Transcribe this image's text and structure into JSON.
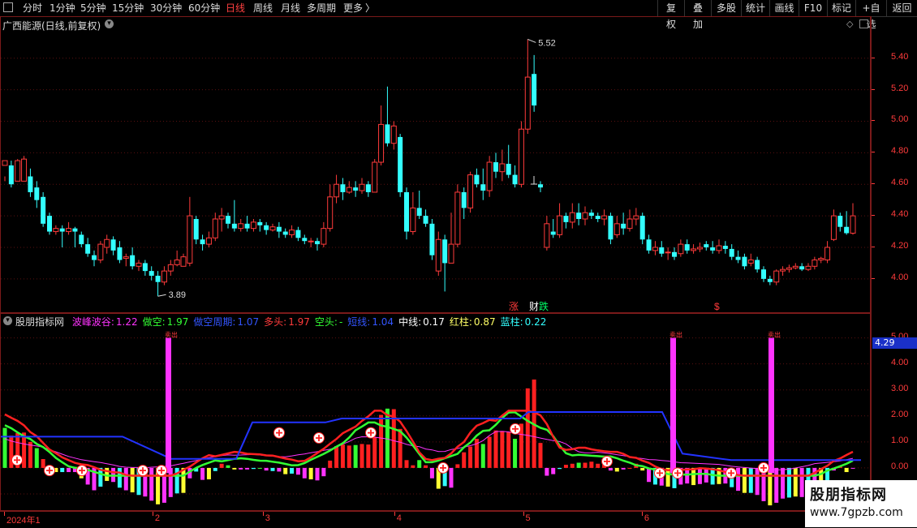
{
  "toolbar": {
    "left_items": [
      {
        "label": "分时",
        "active": false
      },
      {
        "label": "1分钟",
        "active": false
      },
      {
        "label": "5分钟",
        "active": false
      },
      {
        "label": "15分钟",
        "active": false
      },
      {
        "label": "30分钟",
        "active": false
      },
      {
        "label": "60分钟",
        "active": false
      },
      {
        "label": "日线",
        "active": true
      },
      {
        "label": "周线",
        "active": false
      },
      {
        "label": "月线",
        "active": false
      },
      {
        "label": "多周期",
        "active": false
      },
      {
        "label": "更多",
        "active": false
      }
    ],
    "more_arrow": "〉",
    "right_items": [
      "复权",
      "叠加",
      "多股",
      "统计",
      "画线",
      "F10",
      "标记",
      "+自选",
      "返回"
    ]
  },
  "main_chart": {
    "title": "广西能源(日线,前复权)",
    "y_ticks": [
      "5.40",
      "5.20",
      "5.00",
      "4.80",
      "4.60",
      "4.40",
      "4.20",
      "4.00"
    ],
    "y_range": [
      3.85,
      5.62
    ],
    "high_label": "5.52",
    "low_label": "3.89",
    "markers": [
      {
        "text": "涨",
        "color": "#ff3b3b"
      },
      {
        "text": "财",
        "color": "#ffffff"
      },
      {
        "text": "跌",
        "color": "#00ff66"
      },
      {
        "text": "$",
        "color": "#ff3b3b"
      }
    ],
    "candles": [
      [
        4.72,
        4.75,
        4.65,
        4.62
      ],
      [
        4.72,
        4.6,
        4.58,
        4.75
      ],
      [
        4.62,
        4.75,
        4.62,
        4.76
      ],
      [
        4.62,
        4.76,
        4.62,
        4.78
      ],
      [
        4.65,
        4.55,
        4.52,
        4.7
      ],
      [
        4.58,
        4.5,
        4.45,
        4.62
      ],
      [
        4.52,
        4.35,
        4.33,
        4.55
      ],
      [
        4.4,
        4.3,
        4.28,
        4.42
      ],
      [
        4.3,
        4.32,
        4.28,
        4.34
      ],
      [
        4.32,
        4.3,
        4.2,
        4.34
      ],
      [
        4.3,
        4.32,
        4.28,
        4.36
      ],
      [
        4.32,
        4.3,
        4.2,
        4.33
      ],
      [
        4.28,
        4.22,
        4.2,
        4.3
      ],
      [
        4.22,
        4.16,
        4.14,
        4.26
      ],
      [
        4.15,
        4.12,
        4.08,
        4.18
      ],
      [
        4.12,
        4.22,
        4.1,
        4.24
      ],
      [
        4.2,
        4.25,
        4.16,
        4.28
      ],
      [
        4.25,
        4.18,
        4.15,
        4.27
      ],
      [
        4.2,
        4.12,
        4.1,
        4.24
      ],
      [
        4.13,
        4.14,
        4.08,
        4.16
      ],
      [
        4.15,
        4.08,
        4.06,
        4.2
      ],
      [
        4.08,
        4.1,
        4.05,
        4.12
      ],
      [
        4.1,
        4.05,
        4.02,
        4.12
      ],
      [
        4.05,
        4.02,
        3.99,
        4.08
      ],
      [
        4.02,
        3.98,
        3.89,
        4.05
      ],
      [
        3.98,
        4.05,
        3.96,
        4.08
      ],
      [
        4.05,
        4.09,
        4.02,
        4.12
      ],
      [
        4.09,
        4.12,
        4.08,
        4.18
      ],
      [
        4.08,
        4.14,
        4.08,
        4.16
      ],
      [
        4.1,
        4.4,
        4.08,
        4.52
      ],
      [
        4.38,
        4.25,
        4.22,
        4.4
      ],
      [
        4.25,
        4.22,
        4.18,
        4.28
      ],
      [
        4.22,
        4.26,
        4.2,
        4.3
      ],
      [
        4.26,
        4.38,
        4.24,
        4.42
      ],
      [
        4.38,
        4.4,
        4.3,
        4.45
      ],
      [
        4.4,
        4.35,
        4.32,
        4.42
      ],
      [
        4.35,
        4.32,
        4.3,
        4.5
      ],
      [
        4.32,
        4.35,
        4.3,
        4.38
      ],
      [
        4.35,
        4.32,
        4.3,
        4.4
      ],
      [
        4.32,
        4.36,
        4.3,
        4.38
      ],
      [
        4.36,
        4.34,
        4.3,
        4.38
      ],
      [
        4.34,
        4.31,
        4.28,
        4.36
      ],
      [
        4.31,
        4.33,
        4.3,
        4.35
      ],
      [
        4.33,
        4.3,
        4.26,
        4.36
      ],
      [
        4.3,
        4.28,
        4.26,
        4.32
      ],
      [
        4.28,
        4.31,
        4.26,
        4.34
      ],
      [
        4.31,
        4.26,
        4.24,
        4.33
      ],
      [
        4.26,
        4.24,
        4.22,
        4.28
      ],
      [
        4.24,
        4.24,
        4.2,
        4.26
      ],
      [
        4.24,
        4.22,
        4.18,
        4.26
      ],
      [
        4.22,
        4.32,
        4.2,
        4.36
      ],
      [
        4.32,
        4.52,
        4.3,
        4.6
      ],
      [
        4.52,
        4.6,
        4.48,
        4.66
      ],
      [
        4.6,
        4.55,
        4.5,
        4.64
      ],
      [
        4.55,
        4.58,
        4.54,
        4.62
      ],
      [
        4.58,
        4.56,
        4.52,
        4.62
      ],
      [
        4.56,
        4.6,
        4.54,
        4.64
      ],
      [
        4.6,
        4.55,
        4.52,
        4.62
      ],
      [
        4.55,
        4.74,
        4.55,
        4.76
      ],
      [
        4.74,
        4.98,
        4.72,
        5.1
      ],
      [
        4.98,
        4.86,
        4.84,
        5.22
      ],
      [
        4.86,
        4.97,
        4.82,
        5.0
      ],
      [
        4.9,
        4.55,
        4.52,
        4.92
      ],
      [
        4.55,
        4.3,
        4.25,
        4.58
      ],
      [
        4.3,
        4.45,
        4.28,
        4.55
      ],
      [
        4.45,
        4.4,
        4.38,
        4.56
      ],
      [
        4.4,
        4.35,
        4.33,
        4.44
      ],
      [
        4.35,
        4.15,
        4.12,
        4.38
      ],
      [
        4.05,
        4.25,
        4.02,
        4.3
      ],
      [
        4.25,
        4.1,
        3.92,
        4.28
      ],
      [
        4.1,
        4.22,
        4.1,
        4.42
      ],
      [
        4.22,
        4.55,
        4.2,
        4.6
      ],
      [
        4.55,
        4.45,
        4.38,
        4.58
      ],
      [
        4.45,
        4.66,
        4.42,
        4.68
      ],
      [
        4.66,
        4.6,
        4.58,
        4.7
      ],
      [
        4.6,
        4.56,
        4.5,
        4.7
      ],
      [
        4.56,
        4.74,
        4.52,
        4.78
      ],
      [
        4.74,
        4.68,
        4.64,
        4.8
      ],
      [
        4.68,
        4.73,
        4.62,
        4.82
      ],
      [
        4.73,
        4.66,
        4.64,
        4.85
      ],
      [
        4.66,
        4.6,
        4.58,
        4.72
      ],
      [
        4.6,
        4.95,
        4.58,
        5.0
      ],
      [
        4.95,
        5.28,
        4.92,
        5.52
      ],
      [
        5.3,
        5.1,
        5.06,
        5.42
      ],
      [
        4.6,
        4.58,
        4.55,
        4.62
      ],
      [
        4.2,
        4.35,
        4.18,
        4.4
      ],
      [
        4.3,
        4.28,
        4.26,
        4.38
      ],
      [
        4.28,
        4.4,
        4.26,
        4.48
      ],
      [
        4.4,
        4.36,
        4.32,
        4.42
      ],
      [
        4.36,
        4.42,
        4.32,
        4.48
      ],
      [
        4.42,
        4.38,
        4.34,
        4.48
      ],
      [
        4.38,
        4.42,
        4.34,
        4.46
      ],
      [
        4.42,
        4.4,
        4.38,
        4.44
      ],
      [
        4.4,
        4.38,
        4.36,
        4.42
      ],
      [
        4.38,
        4.4,
        4.34,
        4.44
      ],
      [
        4.4,
        4.25,
        4.22,
        4.42
      ],
      [
        4.28,
        4.35,
        4.26,
        4.4
      ],
      [
        4.35,
        4.32,
        4.28,
        4.42
      ],
      [
        4.32,
        4.38,
        4.3,
        4.44
      ],
      [
        4.38,
        4.4,
        4.34,
        4.45
      ],
      [
        4.4,
        4.25,
        4.22,
        4.42
      ],
      [
        4.25,
        4.18,
        4.16,
        4.28
      ],
      [
        4.18,
        4.2,
        4.15,
        4.24
      ],
      [
        4.2,
        4.16,
        4.14,
        4.24
      ],
      [
        4.17,
        4.17,
        4.12,
        4.2
      ],
      [
        4.17,
        4.14,
        4.12,
        4.2
      ],
      [
        4.16,
        4.22,
        4.14,
        4.25
      ],
      [
        4.22,
        4.18,
        4.16,
        4.25
      ],
      [
        4.18,
        4.19,
        4.16,
        4.22
      ],
      [
        4.19,
        4.2,
        4.17,
        4.23
      ],
      [
        4.22,
        4.2,
        4.18,
        4.24
      ],
      [
        4.2,
        4.18,
        4.16,
        4.24
      ],
      [
        4.18,
        4.21,
        4.16,
        4.25
      ],
      [
        4.21,
        4.19,
        4.16,
        4.24
      ],
      [
        4.19,
        4.14,
        4.12,
        4.22
      ],
      [
        4.14,
        4.12,
        4.1,
        4.18
      ],
      [
        4.14,
        4.08,
        4.06,
        4.16
      ],
      [
        4.1,
        4.12,
        4.08,
        4.16
      ],
      [
        4.12,
        4.06,
        4.04,
        4.14
      ],
      [
        4.06,
        4.0,
        3.98,
        4.08
      ],
      [
        4.0,
        3.98,
        3.96,
        4.02
      ],
      [
        3.98,
        4.05,
        3.96,
        4.06
      ],
      [
        4.05,
        4.06,
        4.02,
        4.08
      ],
      [
        4.06,
        4.07,
        4.04,
        4.09
      ],
      [
        4.07,
        4.08,
        4.06,
        4.1
      ],
      [
        4.08,
        4.06,
        4.05,
        4.1
      ],
      [
        4.06,
        4.08,
        4.05,
        4.1
      ],
      [
        4.08,
        4.12,
        4.06,
        4.14
      ],
      [
        4.12,
        4.13,
        4.1,
        4.14
      ],
      [
        4.12,
        4.2,
        4.1,
        4.24
      ],
      [
        4.25,
        4.4,
        4.24,
        4.44
      ],
      [
        4.4,
        4.33,
        4.3,
        4.42
      ],
      [
        4.33,
        4.29,
        4.28,
        4.43
      ],
      [
        4.29,
        4.4,
        4.28,
        4.48
      ]
    ]
  },
  "indicator": {
    "name": "股朋指标网",
    "params": [
      {
        "label": "波峰波谷:",
        "value": "1.22",
        "color": "#ff33ff"
      },
      {
        "label": "做空:",
        "value": "1.97",
        "color": "#33ff33"
      },
      {
        "label": "做空周期:",
        "value": "1.07",
        "color": "#3355ff"
      },
      {
        "label": "多头:",
        "value": "1.97",
        "color": "#ff3b3b"
      },
      {
        "label": "空头:",
        "value": "-",
        "color": "#33ff33"
      },
      {
        "label": "短线:",
        "value": "1.04",
        "color": "#3355ff"
      },
      {
        "label": "中线:",
        "value": "0.17",
        "color": "#ffffff"
      },
      {
        "label": "红柱:",
        "value": "0.87",
        "color": "#ffff66"
      },
      {
        "label": "蓝柱:",
        "value": "0.22",
        "color": "#33ffff"
      }
    ],
    "y_ticks": [
      "5.00",
      "4.00",
      "3.00",
      "2.00",
      "1.00",
      "0.00",
      "-1.00"
    ],
    "y_range": [
      -1.5,
      5.3
    ],
    "current_value": "4.29",
    "signal_text": "卖出"
  },
  "x_axis": {
    "labels": [
      {
        "text": "2024年1",
        "pos": 0.0
      },
      {
        "text": "2",
        "pos": 0.175
      },
      {
        "text": "3",
        "pos": 0.305
      },
      {
        "text": "4",
        "pos": 0.46
      },
      {
        "text": "5",
        "pos": 0.612
      },
      {
        "text": "6",
        "pos": 0.752
      }
    ]
  },
  "watermark": {
    "title": "股朋指标网",
    "url": "www.7gpzb.com"
  },
  "colors": {
    "up": "#ff3b3b",
    "down": "#33ffff",
    "grid": "#5a1010"
  }
}
